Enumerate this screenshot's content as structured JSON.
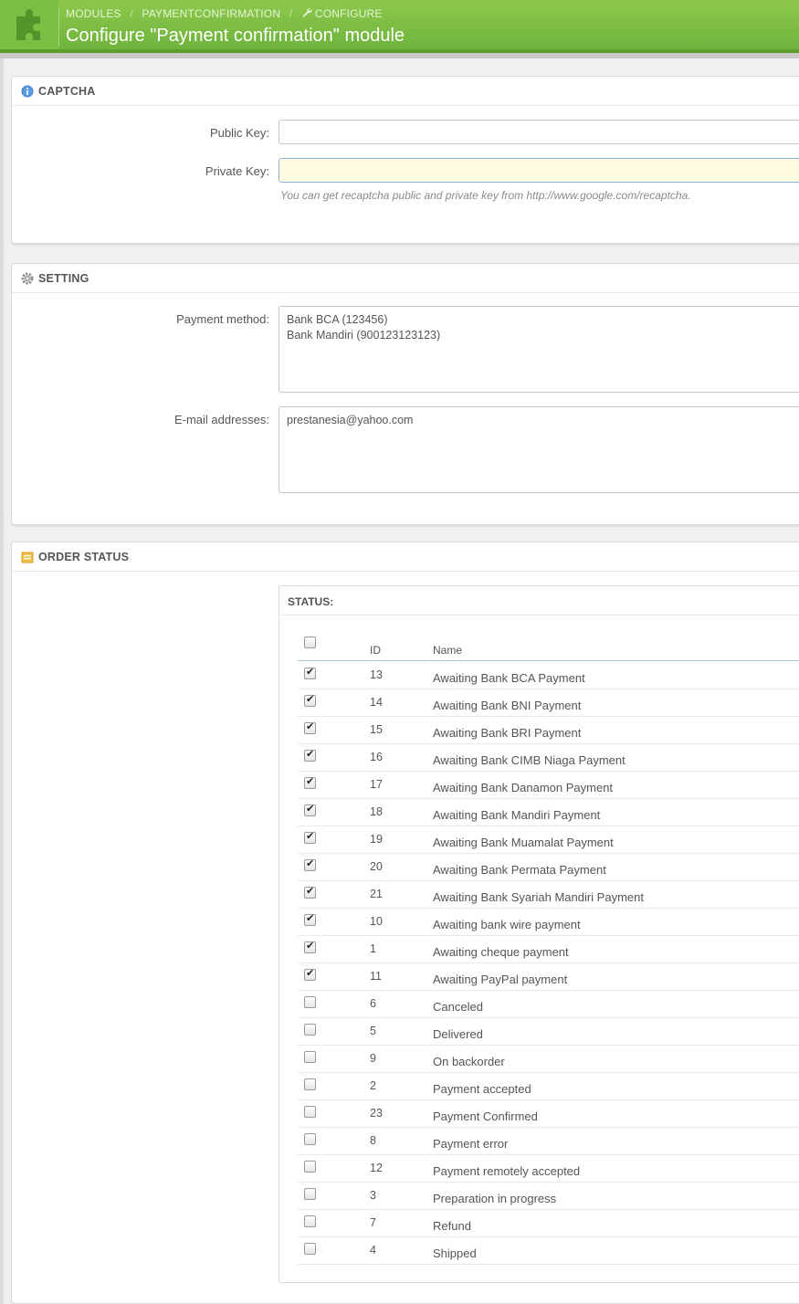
{
  "header": {
    "breadcrumb": [
      "MODULES",
      "PAYMENTCONFIRMATION",
      "CONFIGURE"
    ],
    "breadcrumb_sep": "/",
    "title": "Configure \"Payment confirmation\" module"
  },
  "captcha": {
    "heading": "CAPTCHA",
    "public_key_label": "Public Key:",
    "public_key_value": "",
    "private_key_label": "Private Key:",
    "private_key_value": "",
    "hint": "You can get recaptcha public and private key from http://www.google.com/recaptcha."
  },
  "setting": {
    "heading": "SETTING",
    "payment_method_label": "Payment method:",
    "payment_method_value": "Bank BCA (123456)\nBank Mandiri (900123123123)",
    "email_label": "E-mail addresses:",
    "email_value": "prestanesia@yahoo.com"
  },
  "order_status": {
    "heading": "ORDER STATUS",
    "box_title": "STATUS:",
    "col_id": "ID",
    "col_name": "Name",
    "select_all_checked": false,
    "rows": [
      {
        "checked": true,
        "id": "13",
        "name": "Awaiting Bank BCA Payment"
      },
      {
        "checked": true,
        "id": "14",
        "name": "Awaiting Bank BNI Payment"
      },
      {
        "checked": true,
        "id": "15",
        "name": "Awaiting Bank BRI Payment"
      },
      {
        "checked": true,
        "id": "16",
        "name": "Awaiting Bank CIMB Niaga Payment"
      },
      {
        "checked": true,
        "id": "17",
        "name": "Awaiting Bank Danamon Payment"
      },
      {
        "checked": true,
        "id": "18",
        "name": "Awaiting Bank Mandiri Payment"
      },
      {
        "checked": true,
        "id": "19",
        "name": "Awaiting Bank Muamalat Payment"
      },
      {
        "checked": true,
        "id": "20",
        "name": "Awaiting Bank Permata Payment"
      },
      {
        "checked": true,
        "id": "21",
        "name": "Awaiting Bank Syariah Mandiri Payment"
      },
      {
        "checked": true,
        "id": "10",
        "name": "Awaiting bank wire payment"
      },
      {
        "checked": true,
        "id": "1",
        "name": "Awaiting cheque payment"
      },
      {
        "checked": true,
        "id": "11",
        "name": "Awaiting PayPal payment"
      },
      {
        "checked": false,
        "id": "6",
        "name": "Canceled"
      },
      {
        "checked": false,
        "id": "5",
        "name": "Delivered"
      },
      {
        "checked": false,
        "id": "9",
        "name": "On backorder"
      },
      {
        "checked": false,
        "id": "2",
        "name": "Payment accepted"
      },
      {
        "checked": false,
        "id": "23",
        "name": "Payment Confirmed"
      },
      {
        "checked": false,
        "id": "8",
        "name": "Payment error"
      },
      {
        "checked": false,
        "id": "12",
        "name": "Payment remotely accepted"
      },
      {
        "checked": false,
        "id": "3",
        "name": "Preparation in progress"
      },
      {
        "checked": false,
        "id": "7",
        "name": "Refund"
      },
      {
        "checked": false,
        "id": "4",
        "name": "Shipped"
      }
    ]
  },
  "colors": {
    "header_green": "#7bbf45",
    "focus_yellow": "#fefbe1",
    "table_head_line": "#9fc6e4"
  },
  "icons": {
    "logo": "puzzle-icon",
    "breadcrumb_configure": "wrench-icon",
    "captcha": "info-icon",
    "setting": "gear-icon",
    "order_status": "list-icon"
  }
}
